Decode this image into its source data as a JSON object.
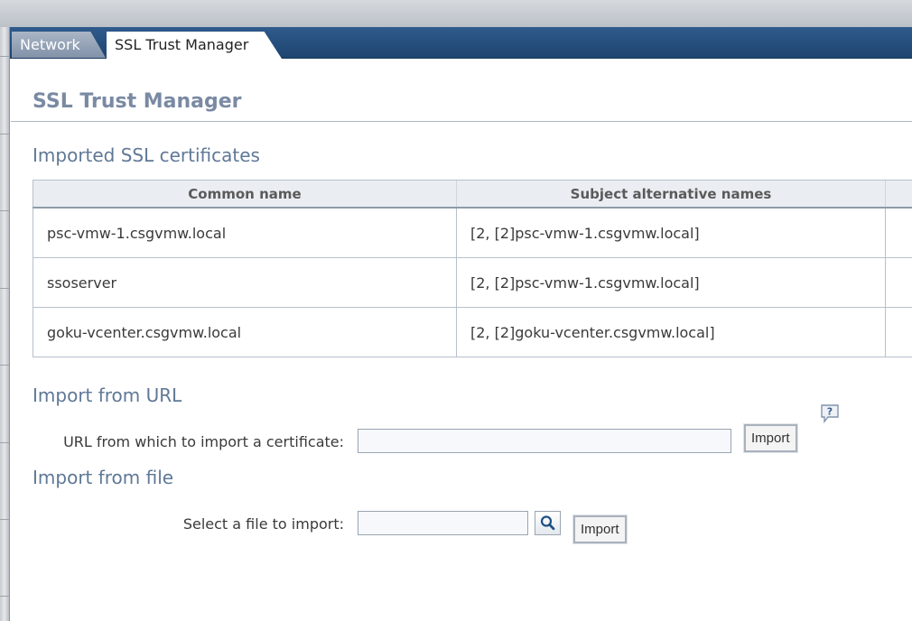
{
  "tabs": [
    {
      "label": "Network"
    },
    {
      "label": "SSL Trust Manager"
    }
  ],
  "page_title": "SSL Trust Manager",
  "imported": {
    "heading": "Imported SSL certificates",
    "columns": [
      "Common name",
      "Subject alternative names"
    ],
    "rows": [
      {
        "common_name": "psc-vmw-1.csgvmw.local",
        "san": "[2, [2]psc-vmw-1.csgvmw.local]"
      },
      {
        "common_name": "ssoserver",
        "san": "[2, [2]psc-vmw-1.csgvmw.local]"
      },
      {
        "common_name": "goku-vcenter.csgvmw.local",
        "san": "[2, [2]goku-vcenter.csgvmw.local]"
      }
    ]
  },
  "import_url": {
    "heading": "Import from URL",
    "label": "URL from which to import a certificate:",
    "value": "",
    "button": "Import",
    "help_icon": "help-question-icon"
  },
  "import_file": {
    "heading": "Import from file",
    "label": "Select a file to import:",
    "value": "",
    "browse_icon": "magnifier-icon",
    "button": "Import"
  },
  "colors": {
    "tabbar": "#1e4470",
    "heading": "#5f7896",
    "title": "#7a8aa3"
  }
}
